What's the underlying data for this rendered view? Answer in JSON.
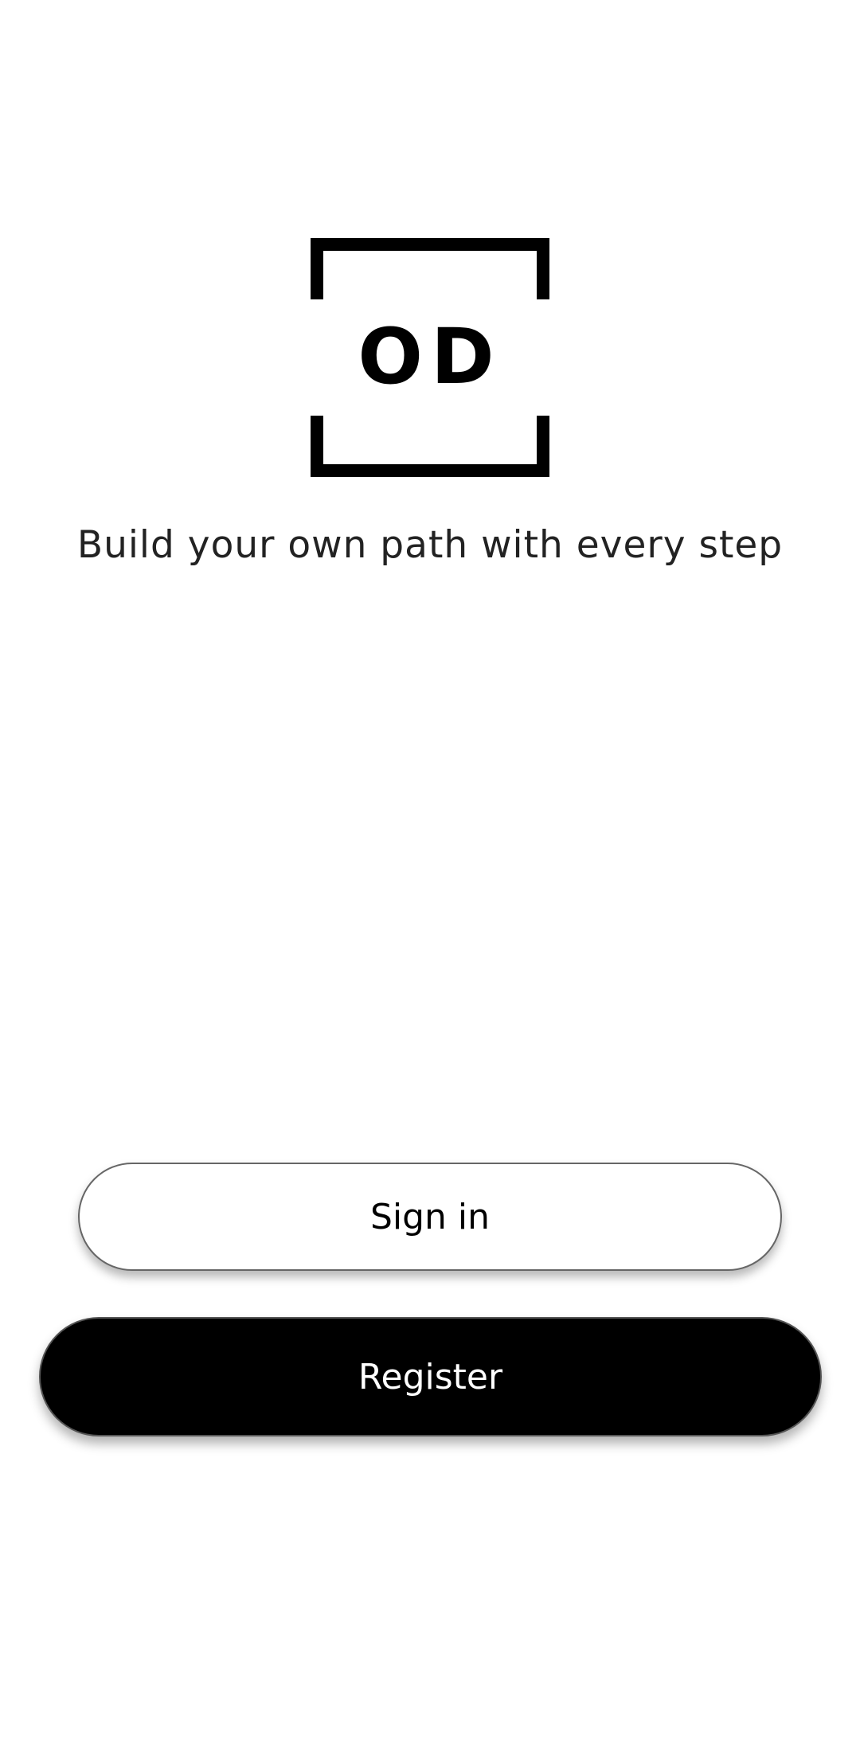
{
  "logo": {
    "text": "OD",
    "color": "#000000"
  },
  "tagline": "Build your own path with every step",
  "buttons": {
    "sign_in_label": "Sign in",
    "register_label": "Register"
  },
  "colors": {
    "background": "#ffffff",
    "primary": "#000000",
    "on_primary": "#ffffff"
  }
}
